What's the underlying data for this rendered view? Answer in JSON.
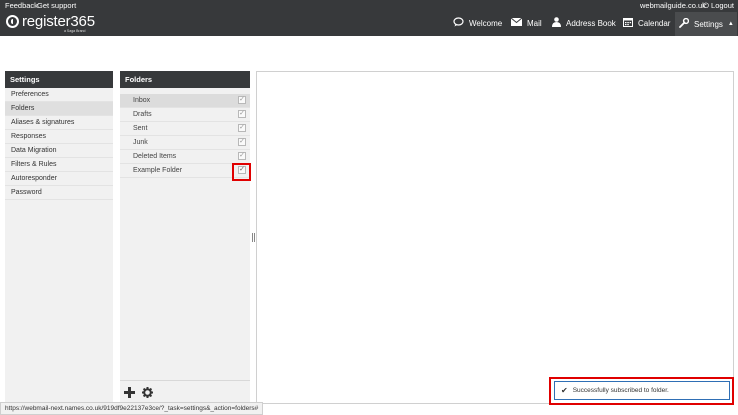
{
  "topbar": {
    "links": {
      "feedback": "Feedback",
      "support": "Get support"
    },
    "domain": "webmailguide.co.uk",
    "logout": "Logout",
    "logo": {
      "text": "register365",
      "sub": "a Saga Brand"
    },
    "nav": [
      {
        "label": "Welcome",
        "icon": "chat-bubble-icon"
      },
      {
        "label": "Mail",
        "icon": "envelope-icon"
      },
      {
        "label": "Address Book",
        "icon": "person-icon"
      },
      {
        "label": "Calendar",
        "icon": "calendar-icon"
      },
      {
        "label": "Settings",
        "icon": "wrench-icon"
      }
    ]
  },
  "settings": {
    "title": "Settings",
    "items": [
      "Preferences",
      "Folders",
      "Aliases & signatures",
      "Responses",
      "Data Migration",
      "Filters & Rules",
      "Autoresponder",
      "Password"
    ],
    "selected": "Folders"
  },
  "folders": {
    "title": "Folders",
    "list": [
      {
        "name": "Inbox",
        "subscribed": true
      },
      {
        "name": "Drafts",
        "subscribed": true
      },
      {
        "name": "Sent",
        "subscribed": true
      },
      {
        "name": "Junk",
        "subscribed": true
      },
      {
        "name": "Deleted Items",
        "subscribed": true
      },
      {
        "name": "Example Folder",
        "subscribed": true
      }
    ]
  },
  "status_url": "https://webmail-next.names.co.uk/919df9e22137e3ce/?_task=settings&_action=folders#",
  "toast": "Successfully subscribed to folder.",
  "colors": {
    "topbar": "#37393b",
    "highlight": "#e00000",
    "toast_border": "#2f6fb5"
  }
}
